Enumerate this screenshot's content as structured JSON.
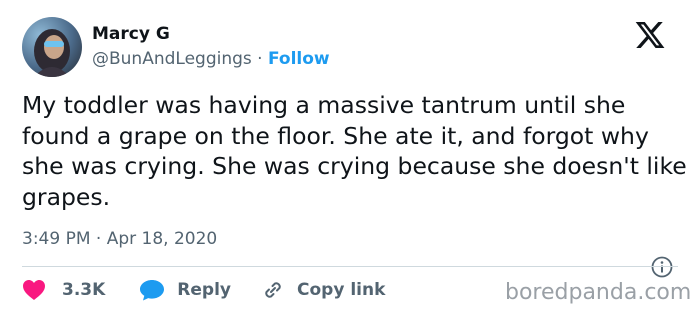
{
  "author": {
    "display_name": "Marcy G",
    "handle": "@BunAndLeggings",
    "separator": "·",
    "follow_label": "Follow"
  },
  "tweet": {
    "text": "My toddler was having a massive tantrum until she found a grape on the floor. She ate it, and forgot why she was crying. She was crying because she doesn't like grapes.",
    "timestamp": "3:49 PM · Apr 18, 2020"
  },
  "actions": {
    "like_count": "3.3K",
    "reply_label": "Reply",
    "copy_link_label": "Copy link"
  },
  "watermark": "boredpanda.com",
  "colors": {
    "like": "#f91880",
    "reply": "#1d9bf0",
    "follow": "#1d9bf0",
    "muted": "#536471"
  },
  "icons": [
    "avatar",
    "x-logo-icon",
    "info-icon",
    "heart-icon",
    "reply-bubble-icon",
    "link-icon"
  ]
}
